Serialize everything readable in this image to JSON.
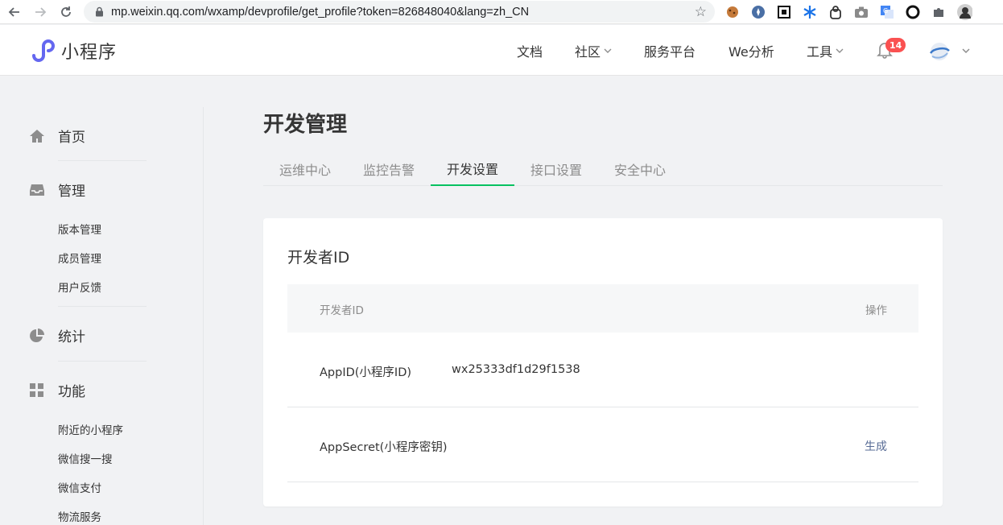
{
  "browser": {
    "url": "mp.weixin.qq.com/wxamp/devprofile/get_profile?token=826848040&lang=zh_CN",
    "back_icon": "back-arrow-icon",
    "forward_icon": "forward-arrow-icon",
    "reload_icon": "reload-icon",
    "extensions": [
      "cookie-icon",
      "compass-icon",
      "qr-frame-icon",
      "snowflake-icon",
      "bag-icon",
      "camera-icon",
      "translate-icon",
      "ring-icon",
      "puzzle-icon",
      "profile-icon"
    ]
  },
  "header": {
    "brand": "小程序",
    "nav": [
      {
        "label": "文档",
        "dropdown": false
      },
      {
        "label": "社区",
        "dropdown": true
      },
      {
        "label": "服务平台",
        "dropdown": false
      },
      {
        "label": "We分析",
        "dropdown": false
      },
      {
        "label": "工具",
        "dropdown": true
      }
    ],
    "notification_count": "14"
  },
  "sidebar": {
    "sections": [
      {
        "label": "首页",
        "icon": "home-icon",
        "items": []
      },
      {
        "label": "管理",
        "icon": "inbox-icon",
        "items": [
          "版本管理",
          "成员管理",
          "用户反馈"
        ]
      },
      {
        "label": "统计",
        "icon": "pie-chart-icon",
        "items": []
      },
      {
        "label": "功能",
        "icon": "grid-icon",
        "items": [
          "附近的小程序",
          "微信搜一搜",
          "微信支付",
          "物流服务"
        ]
      }
    ]
  },
  "main": {
    "title": "开发管理",
    "tabs": [
      {
        "label": "运维中心",
        "active": false
      },
      {
        "label": "监控告警",
        "active": false
      },
      {
        "label": "开发设置",
        "active": true
      },
      {
        "label": "接口设置",
        "active": false
      },
      {
        "label": "安全中心",
        "active": false
      }
    ],
    "card": {
      "title": "开发者ID",
      "columns": [
        "开发者ID",
        "操作"
      ],
      "rows": [
        {
          "name": "AppID(小程序ID)",
          "value": "wx25333df1d29f1538",
          "action": ""
        },
        {
          "name": "AppSecret(小程序密钥)",
          "value": "",
          "action": "生成"
        }
      ]
    }
  },
  "colors": {
    "accent": "#07c160",
    "link": "#576b95",
    "badge": "#fa5151"
  }
}
